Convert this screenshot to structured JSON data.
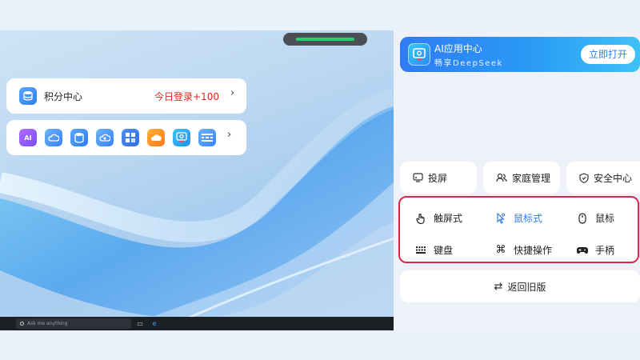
{
  "desktop": {
    "taskbar": {
      "search_placeholder": "Ask me anything"
    }
  },
  "ai_banner": {
    "title": "AI应用中心",
    "subtitle": "畅享DeepSeek",
    "open_label": "立即打开"
  },
  "points": {
    "label": "积分中心",
    "promo": "今日登录+100",
    "chevron": "›"
  },
  "apps": {
    "icons": [
      "ai-writing-icon",
      "cloud-drive-icon",
      "storage-icon",
      "cloud-sync-icon",
      "grid-apps-icon",
      "cloud-orange-icon",
      "ai-assistant-icon",
      "keyboard-app-icon"
    ],
    "chevron": "›"
  },
  "quick_actions": [
    {
      "label": "投屏",
      "icon": "cast-icon"
    },
    {
      "label": "家庭管理",
      "icon": "family-icon"
    },
    {
      "label": "安全中心",
      "icon": "shield-icon"
    }
  ],
  "modes": [
    {
      "label": "触屏式",
      "icon": "touch-icon",
      "active": false
    },
    {
      "label": "鼠标式",
      "icon": "cursor-icon",
      "active": true
    },
    {
      "label": "鼠标",
      "icon": "mouse-icon",
      "active": false
    },
    {
      "label": "键盘",
      "icon": "keyboard-icon",
      "active": false
    },
    {
      "label": "快捷操作",
      "icon": "command-icon",
      "active": false
    },
    {
      "label": "手柄",
      "icon": "gamepad-icon",
      "active": false
    }
  ],
  "back": {
    "label": "返回旧版",
    "icon_glyph": "⇄"
  },
  "colors": {
    "accent": "#2f7bf3",
    "promo": "#e2231a",
    "highlight_border": "#d42a4a",
    "connection_ok": "#22d36b"
  }
}
